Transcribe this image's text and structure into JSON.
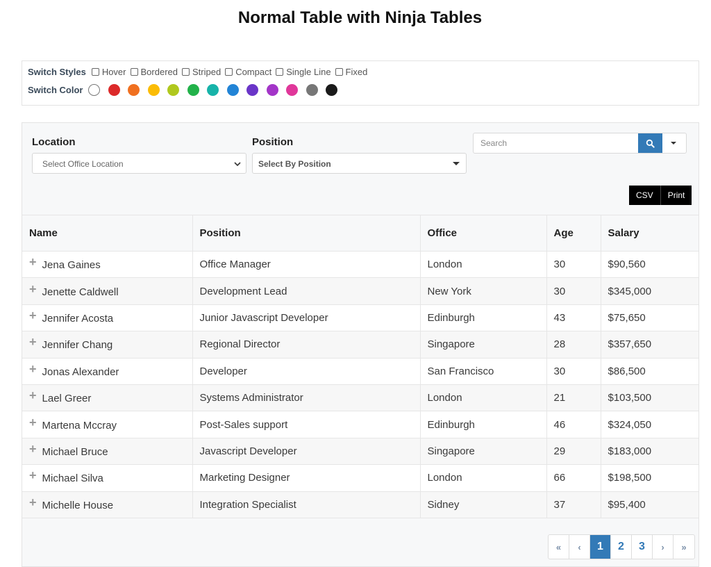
{
  "page": {
    "title": "Normal Table with Ninja Tables"
  },
  "style_switcher": {
    "styles_label": "Switch Styles",
    "styles": [
      {
        "label": "Hover",
        "checked": false
      },
      {
        "label": "Bordered",
        "checked": false
      },
      {
        "label": "Striped",
        "checked": false
      },
      {
        "label": "Compact",
        "checked": false
      },
      {
        "label": "Single Line",
        "checked": false
      },
      {
        "label": "Fixed",
        "checked": false
      }
    ],
    "color_label": "Switch Color",
    "colors": [
      {
        "name": "white",
        "hex": "#ffffff"
      },
      {
        "name": "red",
        "hex": "#dc2a2a"
      },
      {
        "name": "orange",
        "hex": "#f07020"
      },
      {
        "name": "yellow",
        "hex": "#fbbc05"
      },
      {
        "name": "lime",
        "hex": "#b0c81e"
      },
      {
        "name": "green",
        "hex": "#22b24a"
      },
      {
        "name": "teal",
        "hex": "#17b3a9"
      },
      {
        "name": "blue",
        "hex": "#2284d6"
      },
      {
        "name": "indigo",
        "hex": "#6a35c8"
      },
      {
        "name": "purple",
        "hex": "#a335c8"
      },
      {
        "name": "pink",
        "hex": "#e0379a"
      },
      {
        "name": "gray",
        "hex": "#777777"
      },
      {
        "name": "black",
        "hex": "#1a1a1a"
      }
    ]
  },
  "filters": {
    "location": {
      "label": "Location",
      "placeholder": "Select Office Location"
    },
    "position": {
      "label": "Position",
      "placeholder": "Select By Position"
    }
  },
  "search": {
    "placeholder": "Search",
    "value": ""
  },
  "export": {
    "csv_label": "CSV",
    "print_label": "Print"
  },
  "table": {
    "columns": [
      "Name",
      "Position",
      "Office",
      "Age",
      "Salary"
    ],
    "rows": [
      {
        "name": "Jena Gaines",
        "position": "Office Manager",
        "office": "London",
        "age": "30",
        "salary": "$90,560"
      },
      {
        "name": "Jenette Caldwell",
        "position": "Development Lead",
        "office": "New York",
        "age": "30",
        "salary": "$345,000"
      },
      {
        "name": "Jennifer Acosta",
        "position": "Junior Javascript Developer",
        "office": "Edinburgh",
        "age": "43",
        "salary": "$75,650"
      },
      {
        "name": "Jennifer Chang",
        "position": "Regional Director",
        "office": "Singapore",
        "age": "28",
        "salary": "$357,650"
      },
      {
        "name": "Jonas Alexander",
        "position": "Developer",
        "office": "San Francisco",
        "age": "30",
        "salary": "$86,500"
      },
      {
        "name": "Lael Greer",
        "position": "Systems Administrator",
        "office": "London",
        "age": "21",
        "salary": "$103,500"
      },
      {
        "name": "Martena Mccray",
        "position": "Post-Sales support",
        "office": "Edinburgh",
        "age": "46",
        "salary": "$324,050"
      },
      {
        "name": "Michael Bruce",
        "position": "Javascript Developer",
        "office": "Singapore",
        "age": "29",
        "salary": "$183,000"
      },
      {
        "name": "Michael Silva",
        "position": "Marketing Designer",
        "office": "London",
        "age": "66",
        "salary": "$198,500"
      },
      {
        "name": "Michelle House",
        "position": "Integration Specialist",
        "office": "Sidney",
        "age": "37",
        "salary": "$95,400"
      }
    ]
  },
  "pagination": {
    "first": "«",
    "prev": "‹",
    "next": "›",
    "last": "»",
    "pages": [
      "1",
      "2",
      "3"
    ],
    "current_page": "1"
  },
  "theme": {
    "accent": "#337ab7",
    "export_bg": "#000000"
  }
}
